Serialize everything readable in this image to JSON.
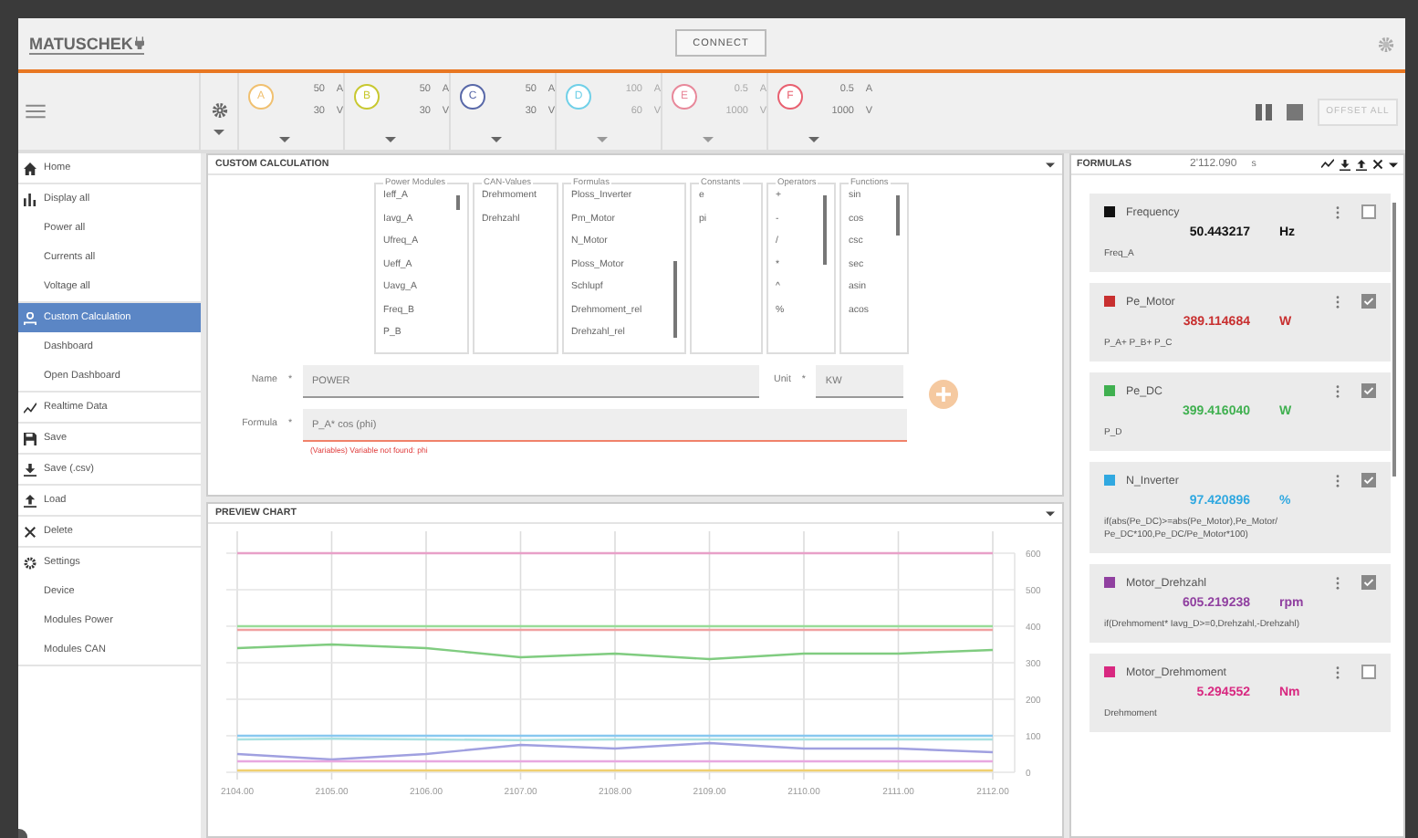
{
  "header": {
    "logo": "MATUSCHEK",
    "connect_button": "CONNECT"
  },
  "channels": [
    {
      "letter": "A",
      "current": "50",
      "current_unit": "A",
      "voltage": "30",
      "voltage_unit": "V",
      "color": "#f0c070",
      "disabled": false
    },
    {
      "letter": "B",
      "current": "50",
      "current_unit": "A",
      "voltage": "30",
      "voltage_unit": "V",
      "color": "#c8c830",
      "disabled": false
    },
    {
      "letter": "C",
      "current": "50",
      "current_unit": "A",
      "voltage": "30",
      "voltage_unit": "V",
      "color": "#5868a8",
      "disabled": false
    },
    {
      "letter": "D",
      "current": "100",
      "current_unit": "A",
      "voltage": "60",
      "voltage_unit": "V",
      "color": "#70d0e8",
      "disabled": true
    },
    {
      "letter": "E",
      "current": "0.5",
      "current_unit": "A",
      "voltage": "1000",
      "voltage_unit": "V",
      "color": "#e8889a",
      "disabled": true
    },
    {
      "letter": "F",
      "current": "0.5",
      "current_unit": "A",
      "voltage": "1000",
      "voltage_unit": "V",
      "color": "#e86070",
      "disabled": false
    }
  ],
  "offset_button": "OFFSET ALL",
  "sidebar": {
    "items": [
      {
        "label": "Home",
        "selected": false
      },
      {
        "label": "Display all",
        "selected": false,
        "children": [
          {
            "label": "Power all",
            "selected": false
          },
          {
            "label": "Currents all",
            "selected": false
          },
          {
            "label": "Voltage all",
            "selected": false
          }
        ]
      },
      {
        "label": "Custom Calculation",
        "selected": true,
        "children": [
          {
            "label": "Dashboard",
            "selected": false
          },
          {
            "label": "Open Dashboard",
            "selected": false
          }
        ]
      },
      {
        "label": "Realtime Data",
        "selected": false
      },
      {
        "label": "Save",
        "selected": false
      },
      {
        "label": "Save (.csv)",
        "selected": false
      },
      {
        "label": "Load",
        "selected": false
      },
      {
        "label": "Delete",
        "selected": false
      },
      {
        "label": "Settings",
        "selected": false,
        "children": [
          {
            "label": "Device",
            "selected": false
          },
          {
            "label": "Modules Power",
            "selected": false
          },
          {
            "label": "Modules CAN",
            "selected": false
          }
        ]
      }
    ]
  },
  "custom_calculation": {
    "title": "CUSTOM CALCULATION",
    "lists": [
      {
        "title": "Power Modules",
        "items": [
          "Ieff_A",
          "Iavg_A",
          "Ufreq_A",
          "Ueff_A",
          "Uavg_A",
          "Freq_B",
          "P_B"
        ]
      },
      {
        "title": "CAN-Values",
        "items": [
          "Drehmoment",
          "Drehzahl"
        ]
      },
      {
        "title": "Formulas",
        "items": [
          "Ploss_Inverter",
          "Pm_Motor",
          "N_Motor",
          "Ploss_Motor",
          "Schlupf",
          "Drehmoment_rel",
          "Drehzahl_rel"
        ]
      },
      {
        "title": "Constants",
        "items": [
          "e",
          "pi"
        ]
      },
      {
        "title": "Operators",
        "items": [
          "+",
          "-",
          "/",
          "*",
          "^",
          "%"
        ]
      },
      {
        "title": "Functions",
        "items": [
          "sin",
          "cos",
          "csc",
          "sec",
          "asin",
          "acos"
        ]
      }
    ],
    "name_label": "Name",
    "name_mark": "*",
    "name_value": "POWER",
    "unit_label": "Unit",
    "unit_mark": "*",
    "unit_value": "KW",
    "formula_label": "Formula",
    "formula_mark": "*",
    "formula_value": "P_A* cos (phi)",
    "error": "(Variables) Variable not found: phi"
  },
  "preview_chart": {
    "title": "PREVIEW CHART",
    "chart_data": {
      "type": "line",
      "x": [
        2104,
        2105,
        2106,
        2107,
        2108,
        2109,
        2110,
        2111,
        2112
      ],
      "xticks": [
        {
          "value": 2104,
          "label": "2104.00"
        },
        {
          "value": 2105,
          "label": "2105.00"
        },
        {
          "value": 2106,
          "label": "2106.00"
        },
        {
          "value": 2107,
          "label": "2107.00"
        },
        {
          "value": 2108,
          "label": "2108.00"
        },
        {
          "value": 2109,
          "label": "2109.00"
        },
        {
          "value": 2110,
          "label": "2110.00"
        },
        {
          "value": 2111,
          "label": "2111.00"
        },
        {
          "value": 2112,
          "label": "2112.00"
        }
      ],
      "yticks": [
        0,
        100,
        200,
        300,
        400,
        500,
        600
      ],
      "xlim": [
        2104,
        2112
      ],
      "ylim": [
        0,
        600
      ],
      "grid": true,
      "series": [
        {
          "color": "#e8a0c8",
          "values": [
            600,
            600,
            600,
            600,
            600,
            600,
            600,
            600,
            600
          ]
        },
        {
          "color": "#98dc98",
          "values": [
            400,
            400,
            400,
            400,
            400,
            400,
            400,
            400,
            400
          ]
        },
        {
          "color": "#f0a0a0",
          "values": [
            390,
            390,
            390,
            390,
            390,
            390,
            390,
            390,
            390
          ]
        },
        {
          "color": "#80cc80",
          "values": [
            340,
            350,
            340,
            315,
            325,
            310,
            325,
            325,
            335
          ]
        },
        {
          "color": "#88c8f0",
          "values": [
            100,
            100,
            100,
            100,
            100,
            100,
            100,
            100,
            100
          ]
        },
        {
          "color": "#a8e0e0",
          "values": [
            90,
            92,
            90,
            88,
            90,
            90,
            90,
            90,
            90
          ]
        },
        {
          "color": "#a0a0e0",
          "values": [
            50,
            35,
            50,
            75,
            65,
            80,
            65,
            65,
            55
          ]
        },
        {
          "color": "#e8a8e0",
          "values": [
            30,
            30,
            30,
            30,
            30,
            30,
            30,
            30,
            30
          ]
        },
        {
          "color": "#f0d070",
          "values": [
            5,
            5,
            5,
            5,
            5,
            5,
            5,
            5,
            5
          ]
        }
      ]
    }
  },
  "formulas_panel": {
    "title": "FORMULAS",
    "time": "2'112.090",
    "time_unit": "s",
    "cards": [
      {
        "name": "Frequency",
        "value": "50.443217",
        "unit": "Hz",
        "formula": "Freq_A",
        "color": "#111111",
        "checked": false
      },
      {
        "name": "Pe_Motor",
        "value": "389.114684",
        "unit": "W",
        "formula": "P_A+ P_B+ P_C",
        "color": "#c83030",
        "checked": true
      },
      {
        "name": "Pe_DC",
        "value": "399.416040",
        "unit": "W",
        "formula": "P_D",
        "color": "#40b050",
        "checked": true
      },
      {
        "name": "N_Inverter",
        "value": "97.420896",
        "unit": "%",
        "formula": "if(abs(Pe_DC)>=abs(Pe_Motor),Pe_Motor/ Pe_DC*100,Pe_DC/Pe_Motor*100)",
        "color": "#30a8e0",
        "checked": true
      },
      {
        "name": "Motor_Drehzahl",
        "value": "605.219238",
        "unit": "rpm",
        "formula": "if(Drehmoment* Iavg_D>=0,Drehzahl,-Drehzahl)",
        "color": "#9040a0",
        "checked": true
      },
      {
        "name": "Motor_Drehmoment",
        "value": "5.294552",
        "unit": "Nm",
        "formula": "Drehmoment",
        "color": "#d82880",
        "checked": false
      }
    ]
  }
}
